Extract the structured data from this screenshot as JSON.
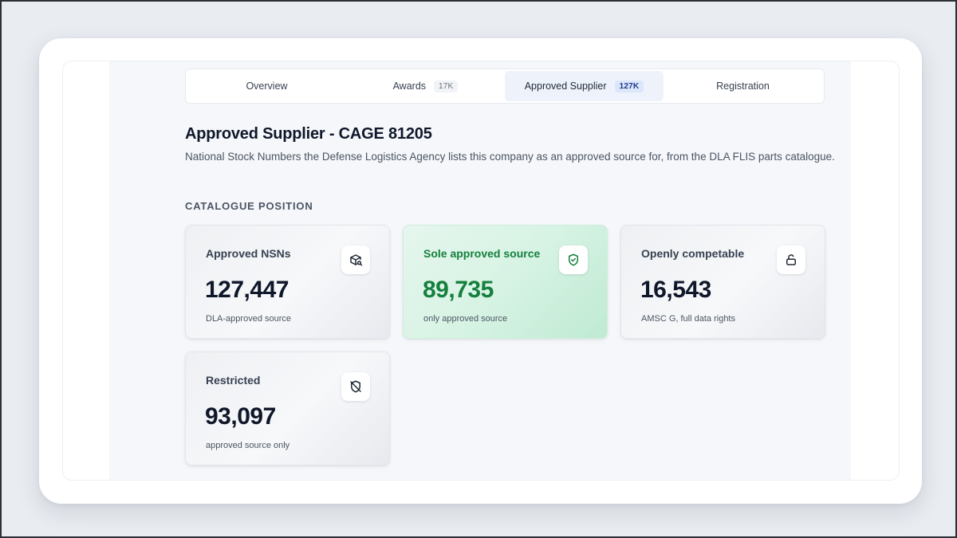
{
  "tabs": [
    {
      "label": "Overview",
      "badge": ""
    },
    {
      "label": "Awards",
      "badge": "17K"
    },
    {
      "label": "Approved Supplier",
      "badge": "127K"
    },
    {
      "label": "Registration",
      "badge": ""
    }
  ],
  "active_tab": "Approved Supplier",
  "page": {
    "title": "Approved Supplier - CAGE 81205",
    "description": "National Stock Numbers the Defense Logistics Agency lists this company as an approved source for, from the DLA FLIS parts catalogue.",
    "section_label": "CATALOGUE POSITION"
  },
  "cards": [
    {
      "label": "Approved NSNs",
      "value": "127,447",
      "sub": "DLA-approved source",
      "icon": "package-search-icon"
    },
    {
      "label": "Sole approved source",
      "value": "89,735",
      "sub": "only approved source",
      "icon": "shield-check-icon"
    },
    {
      "label": "Openly competable",
      "value": "16,543",
      "sub": "AMSC G, full data rights",
      "icon": "unlock-icon"
    },
    {
      "label": "Restricted",
      "value": "93,097",
      "sub": "approved source only",
      "icon": "shield-off-icon"
    }
  ],
  "colors": {
    "accent_green": "#15803d",
    "active_tab_bg": "#eef3fb",
    "text_dark": "#0f172a"
  }
}
